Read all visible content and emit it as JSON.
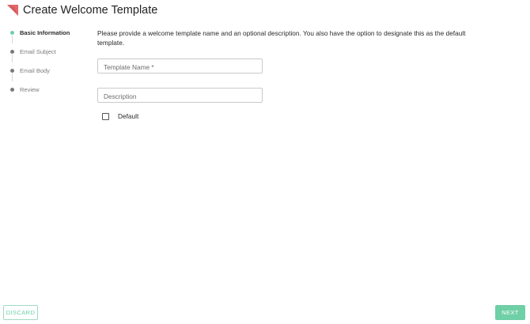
{
  "header": {
    "title": "Create Welcome Template",
    "logo_color": "#e2686b"
  },
  "stepper": {
    "active_index": 0,
    "active_color": "#6fcfa6",
    "steps": [
      {
        "label": "Basic Information"
      },
      {
        "label": "Email Subject"
      },
      {
        "label": "Email Body"
      },
      {
        "label": "Review"
      }
    ]
  },
  "form": {
    "instructions": "Please provide a welcome template name and an optional description. You also have the option to designate this as the default template.",
    "template_name": {
      "placeholder": "Template Name *",
      "value": ""
    },
    "description": {
      "placeholder": "Description",
      "value": ""
    },
    "default_checkbox": {
      "label": "Default",
      "checked": false
    }
  },
  "footer": {
    "discard_label": "DISCARD",
    "next_label": "NEXT"
  }
}
